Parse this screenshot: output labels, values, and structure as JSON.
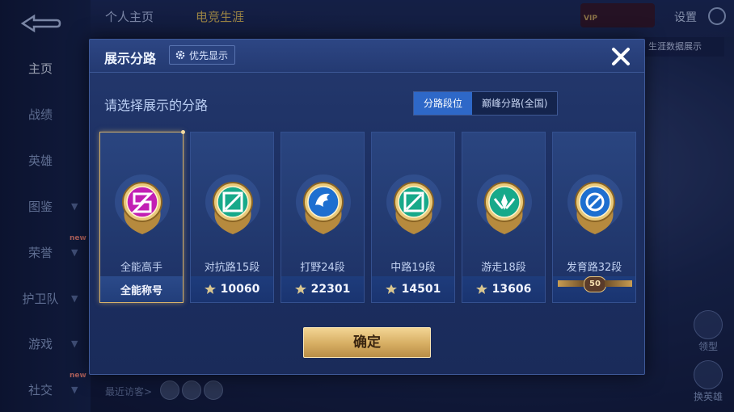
{
  "background": {
    "tabs": [
      "个人主页",
      "电竞生涯"
    ],
    "settings_label": "设置",
    "side_note": "生涯数据展示",
    "visitors_label": "最近访客>",
    "sidebar": [
      {
        "label": "主页",
        "active": true,
        "badge": "",
        "chevron": false
      },
      {
        "label": "战绩",
        "active": false,
        "badge": "",
        "chevron": false
      },
      {
        "label": "英雄",
        "active": false,
        "badge": "",
        "chevron": false
      },
      {
        "label": "图鉴",
        "active": false,
        "badge": "",
        "chevron": true
      },
      {
        "label": "荣誉",
        "active": false,
        "badge": "new",
        "chevron": true
      },
      {
        "label": "护卫队",
        "active": false,
        "badge": "",
        "chevron": true
      },
      {
        "label": "游戏",
        "active": false,
        "badge": "",
        "chevron": true
      },
      {
        "label": "社交",
        "active": false,
        "badge": "new",
        "chevron": true
      }
    ],
    "fab_labels": [
      "领型",
      "换英雄"
    ]
  },
  "modal": {
    "title": "展示分路",
    "priority_button": "优先显示",
    "subtitle": "请选择展示的分路",
    "segments": [
      "分路段位",
      "巅峰分路(全国)"
    ],
    "active_segment": 0,
    "confirm_label": "确定",
    "cards": [
      {
        "name": "全能高手",
        "footer": "全能称号",
        "score": "",
        "selected": true,
        "badge_color": "#c21fb4",
        "icon": "all-round-icon"
      },
      {
        "name": "对抗路15段",
        "footer": "",
        "score": "10060",
        "selected": false,
        "badge_color": "#17a98a",
        "icon": "clash-lane-icon"
      },
      {
        "name": "打野24段",
        "footer": "",
        "score": "22301",
        "selected": false,
        "badge_color": "#1e6fd0",
        "icon": "jungle-icon"
      },
      {
        "name": "中路19段",
        "footer": "",
        "score": "14501",
        "selected": false,
        "badge_color": "#17a98a",
        "icon": "mid-lane-icon"
      },
      {
        "name": "游走18段",
        "footer": "",
        "score": "13606",
        "selected": false,
        "badge_color": "#17a98a",
        "icon": "roam-icon"
      },
      {
        "name": "发育路32段",
        "footer": "",
        "score": "",
        "level": "50",
        "selected": false,
        "badge_color": "#1e6fd0",
        "icon": "farm-lane-icon"
      }
    ]
  }
}
